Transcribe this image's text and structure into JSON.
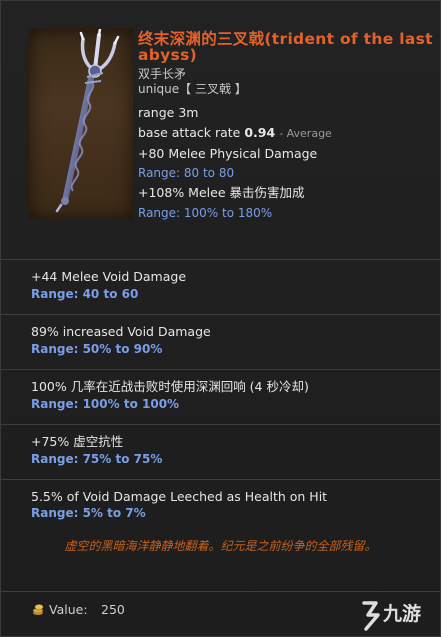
{
  "item": {
    "name": "终末深渊的三叉戟(trident of the last abyss)",
    "type": "双手长矛",
    "rarity": "unique【 三叉戟 】",
    "range": "range 3m",
    "attack_rate_label": "base attack rate",
    "attack_rate_value": "0.94",
    "attack_rate_note": "- Average",
    "implicits": [
      {
        "text": "+80 Melee Physical Damage",
        "range": "Range: 80 to 80"
      },
      {
        "text": "+108% Melee 暴击伤害加成",
        "range": "Range: 100% to 180%"
      }
    ]
  },
  "affixes": [
    {
      "text": "+44 Melee Void Damage",
      "range": "Range: 40 to 60"
    },
    {
      "text": "89% increased Void Damage",
      "range": "Range: 50% to 90%"
    },
    {
      "text": "100% 几率在近战击败时使用深渊回响 (4 秒冷却)",
      "range": "Range: 100% to 100%"
    },
    {
      "text": "+75% 虚空抗性",
      "range": "Range: 75% to 75%"
    },
    {
      "text": "5.5% of Void Damage Leeched as Health on Hit",
      "range": "Range: 5% to 7%"
    }
  ],
  "lore": "虚空的黑暗海洋静静地翻着。纪元是之前纷争的全部残留。",
  "footer": {
    "value_label": "Value:",
    "value": "250",
    "coin_icon": "coin-stack-icon",
    "watermark": "九游"
  },
  "colors": {
    "title": "#e4622a",
    "range": "#7a9ee8",
    "lore": "#c8611e"
  }
}
